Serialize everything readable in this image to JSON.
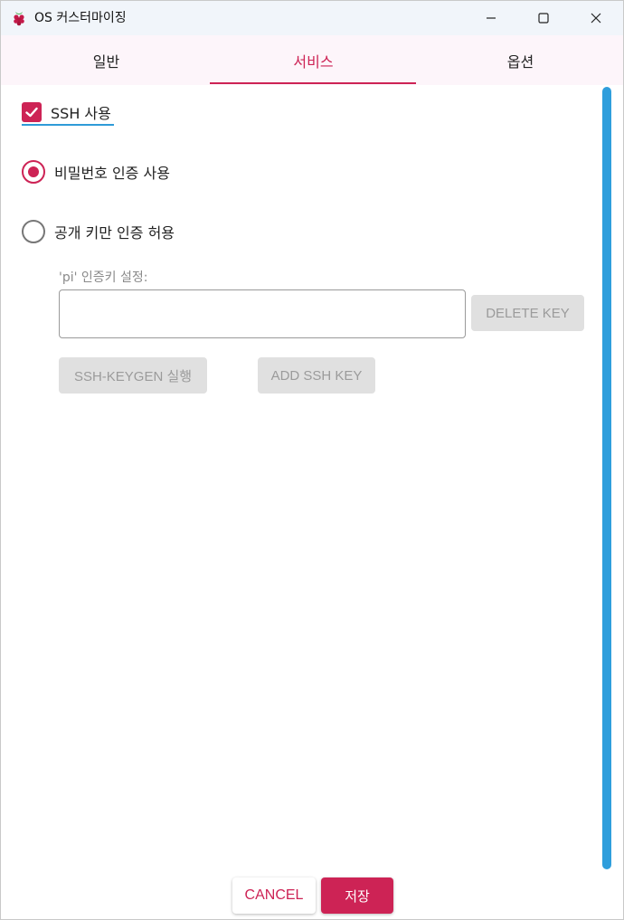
{
  "window": {
    "title": "OS 커스터마이징",
    "controls": {
      "minimize": "minimize",
      "maximize": "maximize",
      "close": "close"
    }
  },
  "tabs": [
    {
      "label": "일반",
      "active": false
    },
    {
      "label": "서비스",
      "active": true
    },
    {
      "label": "옵션",
      "active": false
    }
  ],
  "ssh": {
    "enable_label": "SSH 사용",
    "enabled": true,
    "auth_password_label": "비밀번호 인증 사용",
    "auth_pubkey_label": "공개 키만 인증 허용",
    "selected": "password",
    "key_field_label": "'pi' 인증키 설정:",
    "key_value": "",
    "delete_key_label": "DELETE KEY",
    "keygen_label": "SSH-KEYGEN 실행",
    "add_key_label": "ADD SSH KEY"
  },
  "footer": {
    "cancel_label": "CANCEL",
    "save_label": "저장"
  },
  "colors": {
    "accent": "#cd2355",
    "scrollbar": "#2f9edc",
    "tabbar_bg": "#fdf5fa",
    "titlebar_bg": "#f1f5fa",
    "disabled_btn": "#e0e0e0"
  },
  "icons": {
    "app": "raspberry-icon",
    "checkbox": "checkmark-icon",
    "minimize": "minimize-icon",
    "maximize": "maximize-icon",
    "close": "close-icon"
  }
}
